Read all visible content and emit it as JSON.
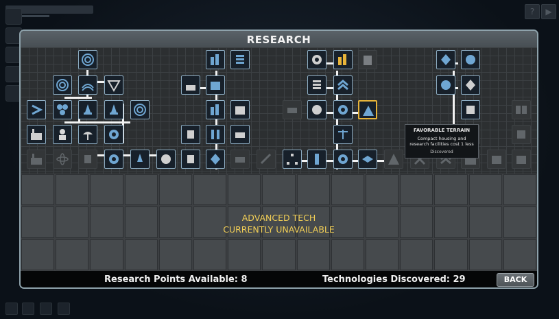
{
  "window": {
    "title": "RESEARCH"
  },
  "tooltip": {
    "name": "FAVORABLE TERRAIN",
    "description": "Compact housing and research facilities cost 1 less",
    "status": "Discovered"
  },
  "advanced_message": {
    "line1": "ADVANCED TECH",
    "line2": "CURRENTLY UNAVAILABLE"
  },
  "footer": {
    "research_points": "Research Points Available: 8",
    "technologies": "Technologies Discovered: 29",
    "back_label": "BACK"
  },
  "colors": {
    "discovered_icon": "#6fa6d2",
    "selected_border": "#e7b43a",
    "locked_icon": "#61666a",
    "accent_text": "#f1ce56"
  },
  "tech_nodes": [
    {
      "id": "n01",
      "icon": "swirl-icon",
      "discovered": true
    },
    {
      "id": "n02",
      "icon": "swirl-icon",
      "discovered": true
    },
    {
      "id": "n03",
      "icon": "wave-icon",
      "discovered": true
    },
    {
      "id": "n04",
      "icon": "hex-grid-icon",
      "discovered": true
    },
    {
      "id": "n05",
      "icon": "chevron-icon",
      "discovered": true
    },
    {
      "id": "n06",
      "icon": "biohazard-icon",
      "discovered": true
    },
    {
      "id": "n07",
      "icon": "rocket-icon",
      "discovered": true
    },
    {
      "id": "n08",
      "icon": "rocket-icon",
      "discovered": true
    },
    {
      "id": "n09",
      "icon": "swirl-icon",
      "discovered": true
    },
    {
      "id": "n10",
      "icon": "factory-icon",
      "discovered": true
    },
    {
      "id": "n11",
      "icon": "person-icon",
      "discovered": true
    },
    {
      "id": "n12",
      "icon": "dish-icon",
      "discovered": true
    },
    {
      "id": "n13",
      "icon": "gear-icon",
      "discovered": true
    },
    {
      "id": "n14",
      "icon": "factory-icon",
      "discovered": false
    },
    {
      "id": "n15",
      "icon": "atom-icon",
      "discovered": false
    },
    {
      "id": "n16",
      "icon": "robot-icon",
      "discovered": false
    },
    {
      "id": "n17",
      "icon": "gear-icon",
      "discovered": true
    },
    {
      "id": "n18",
      "icon": "rocket-icon",
      "discovered": true
    },
    {
      "id": "n19",
      "icon": "planet-icon",
      "discovered": true
    },
    {
      "id": "n20",
      "icon": "city-icon",
      "discovered": true
    },
    {
      "id": "n21",
      "icon": "stack-icon",
      "discovered": true
    },
    {
      "id": "n22",
      "icon": "dish-icon",
      "discovered": true
    },
    {
      "id": "n23",
      "icon": "box-icon",
      "discovered": true
    },
    {
      "id": "n24",
      "icon": "city-icon",
      "discovered": true
    },
    {
      "id": "n25",
      "icon": "box-icon",
      "discovered": true
    },
    {
      "id": "n26",
      "icon": "tubes-icon",
      "discovered": true
    },
    {
      "id": "n27",
      "icon": "robot-icon",
      "discovered": true
    },
    {
      "id": "n28",
      "icon": "crystal-icon",
      "discovered": true
    },
    {
      "id": "n29",
      "icon": "hex-grid-icon",
      "discovered": false
    },
    {
      "id": "n30",
      "icon": "gear-icon",
      "discovered": true
    },
    {
      "id": "n31",
      "icon": "stack-icon",
      "discovered": true
    },
    {
      "id": "n32",
      "icon": "gear-icon",
      "discovered": true
    },
    {
      "id": "n33",
      "icon": "chevron-icon",
      "discovered": true
    },
    {
      "id": "n34",
      "icon": "scales-icon",
      "discovered": true
    },
    {
      "id": "n35",
      "icon": "mountain-icon",
      "discovered": true
    },
    {
      "id": "n36",
      "icon": "crystal-icon",
      "discovered": true
    },
    {
      "id": "n37",
      "icon": "crystal-icon",
      "discovered": true
    },
    {
      "id": "n38",
      "icon": "book-icon",
      "discovered": false
    }
  ]
}
